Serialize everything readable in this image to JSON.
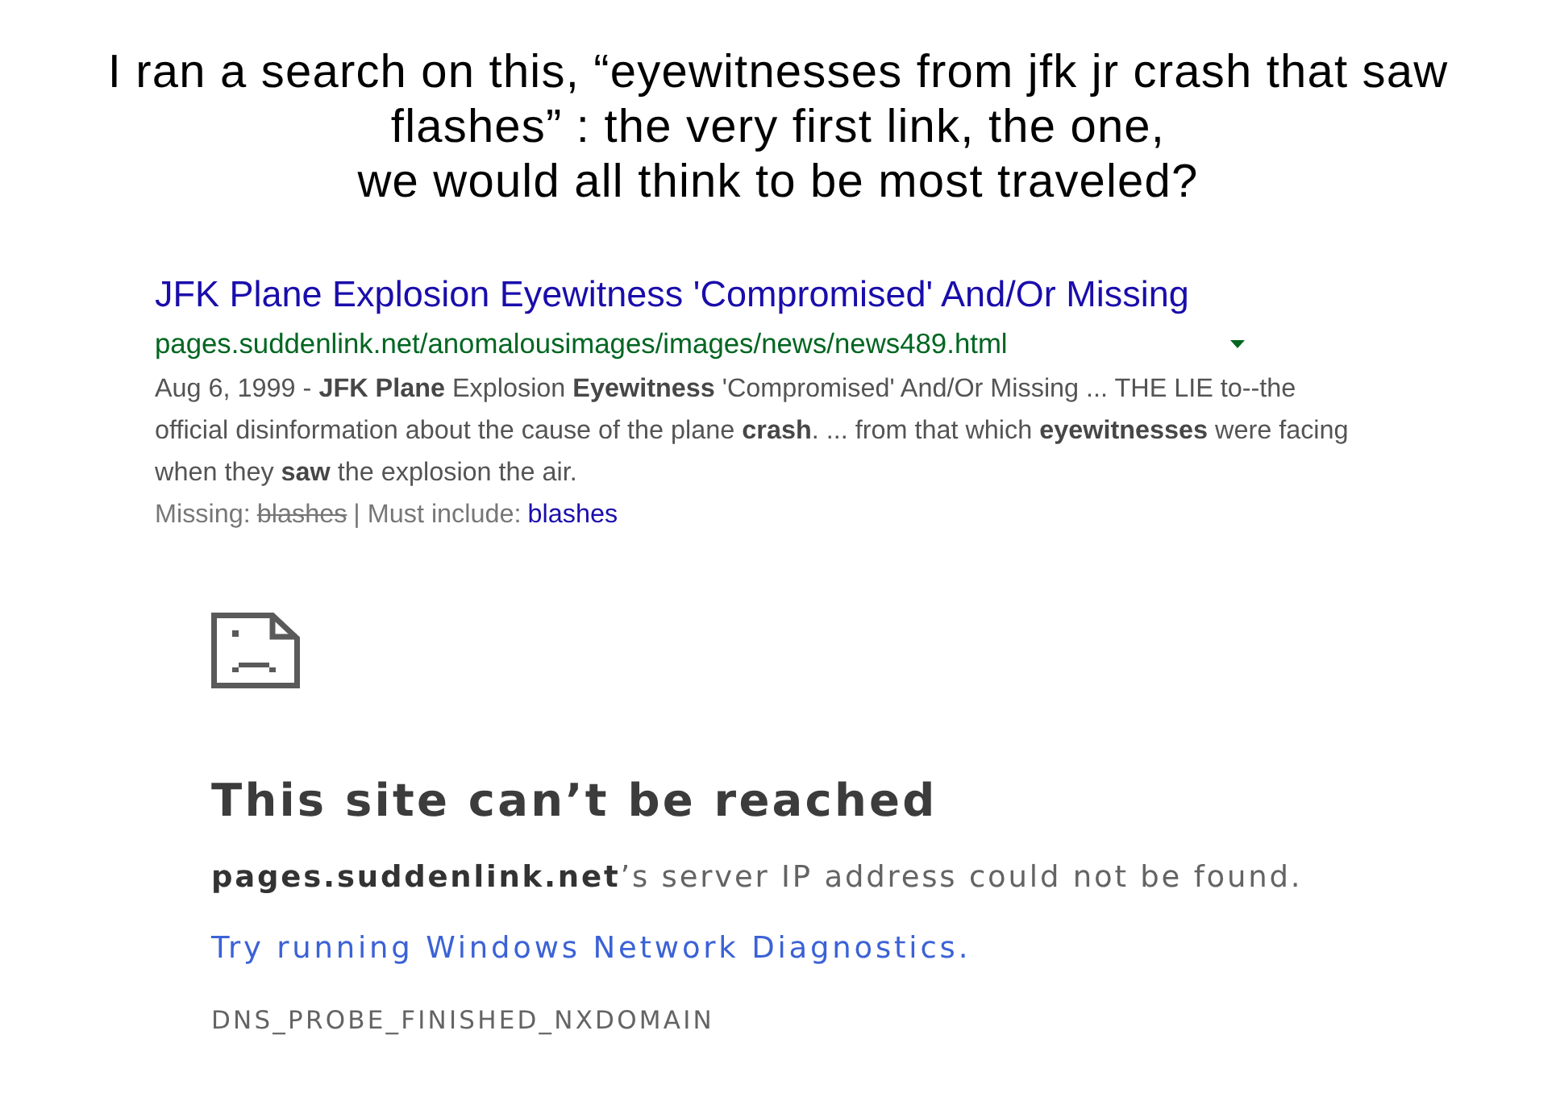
{
  "caption": "I ran a search on this, “eyewitnesses from jfk jr crash that saw\nflashes” : the very first link, the one,\nwe would all think to be most traveled?",
  "search_result": {
    "title": "JFK Plane Explosion Eyewitness 'Compromised' And/Or Missing",
    "url": "pages.suddenlink.net/anomalousimages/images/news/news489.html",
    "snippet": "Aug 6, 1999 - **JFK Plane** Explosion **Eyewitness** 'Compromised' And/Or Missing ... THE LIE to--the\nofficial disinformation about the cause of the plane **crash**. ... from that which **eyewitnesses** were facing\nwhen they **saw** the explosion the air.",
    "missing_label": "Missing:",
    "missing_term": "blashes",
    "must_include_label": "| Must include:",
    "must_include_term": "blashes"
  },
  "error_page": {
    "title": "This site can’t be reached",
    "message": "**pages.suddenlink.net**’s server IP address could not be found.",
    "link": "Try running Windows Network Diagnostics.",
    "error_code": "DNS_PROBE_FINISHED_NXDOMAIN"
  }
}
